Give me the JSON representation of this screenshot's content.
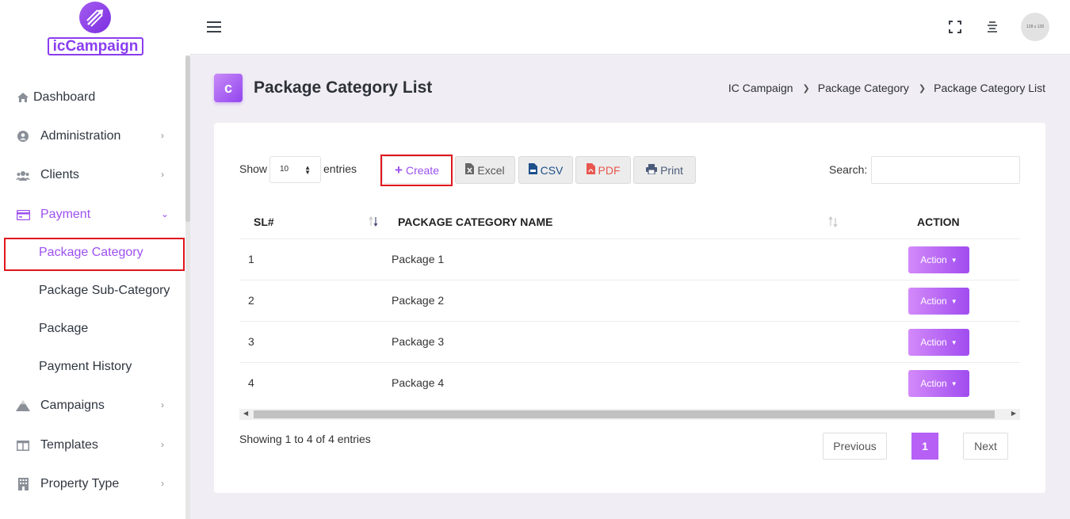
{
  "brand": {
    "logo_text": "icCampaign"
  },
  "sidebar": {
    "items": [
      {
        "label": "Dashboard"
      },
      {
        "label": "Administration"
      },
      {
        "label": "Clients"
      },
      {
        "label": "Payment"
      },
      {
        "label": "Package Category"
      },
      {
        "label": "Package Sub-Category"
      },
      {
        "label": "Package"
      },
      {
        "label": "Payment History"
      },
      {
        "label": "Campaigns"
      },
      {
        "label": "Templates"
      },
      {
        "label": "Property Type"
      }
    ]
  },
  "topbar": {
    "avatar_text": "128 x 128"
  },
  "page": {
    "title_icon_letter": "c",
    "title": "Package Category List",
    "breadcrumb": [
      "IC Campaign",
      "Package Category",
      "Package Category List"
    ]
  },
  "table_controls": {
    "show_label": "Show",
    "entries_label": "entries",
    "page_length": "10",
    "buttons": {
      "create": "Create",
      "excel": "Excel",
      "csv": "CSV",
      "pdf": "PDF",
      "print": "Print"
    },
    "search_label": "Search:",
    "search_value": ""
  },
  "table": {
    "columns": [
      "SL#",
      "PACKAGE CATEGORY NAME",
      "ACTION"
    ],
    "rows": [
      {
        "sl": "1",
        "name": "Package 1",
        "action": "Action"
      },
      {
        "sl": "2",
        "name": "Package 2",
        "action": "Action"
      },
      {
        "sl": "3",
        "name": "Package 3",
        "action": "Action"
      },
      {
        "sl": "4",
        "name": "Package 4",
        "action": "Action"
      }
    ]
  },
  "footer": {
    "info": "Showing 1 to 4 of 4 entries",
    "previous": "Previous",
    "current_page": "1",
    "next": "Next"
  },
  "colors": {
    "accent": "#9d50f0",
    "highlight_box": "#e0161c",
    "page_bg": "#f1edf4"
  }
}
